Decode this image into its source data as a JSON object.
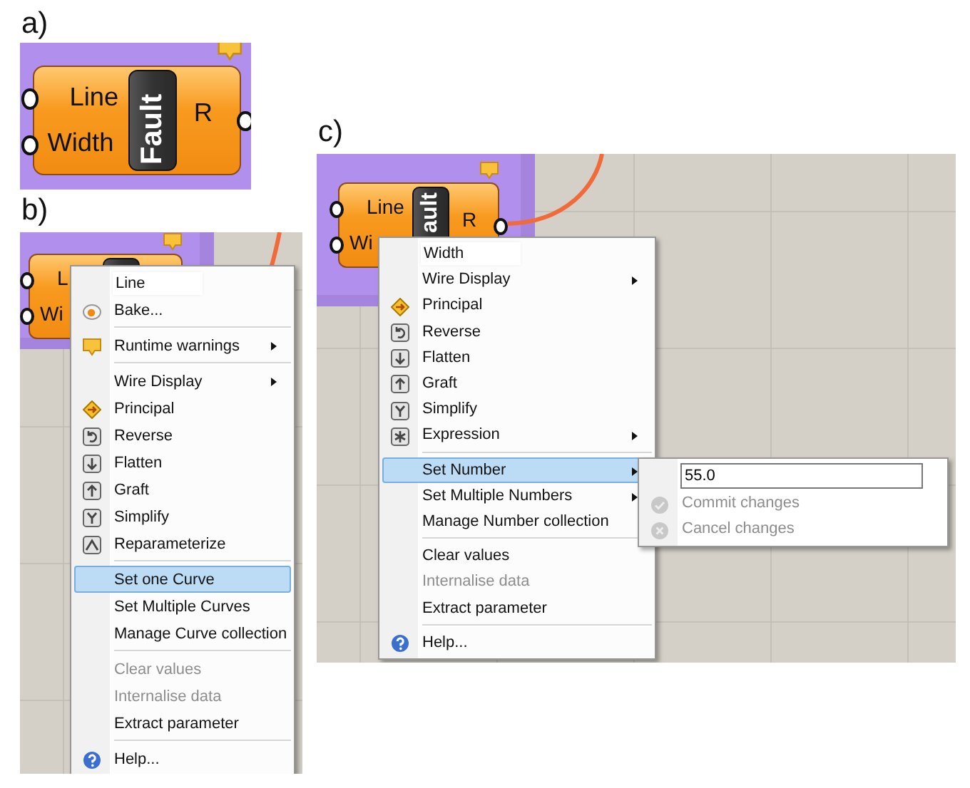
{
  "panels": [
    {
      "label": "a)",
      "grid": false,
      "node": {
        "inputs": [
          "Line",
          "Width"
        ],
        "name": "Fault",
        "output": "R",
        "warning": true
      }
    },
    {
      "label": "b)",
      "grid": true,
      "node": {
        "inputs": [
          "L",
          "Wi"
        ],
        "warning": true,
        "wire": true
      },
      "menu": {
        "items": [
          {
            "kind": "header",
            "label": "Line"
          },
          {
            "kind": "item",
            "label": "Bake...",
            "submenu": false,
            "disabled": false,
            "selected": false
          },
          {
            "kind": "separator"
          },
          {
            "kind": "item",
            "label": "Runtime warnings",
            "submenu": true,
            "disabled": false,
            "selected": false
          },
          {
            "kind": "separator"
          },
          {
            "kind": "item",
            "label": "Wire Display",
            "submenu": true,
            "disabled": false,
            "selected": false
          },
          {
            "kind": "item",
            "label": "Principal",
            "submenu": false,
            "disabled": false,
            "selected": false
          },
          {
            "kind": "item",
            "label": "Reverse",
            "submenu": false,
            "disabled": false,
            "selected": false
          },
          {
            "kind": "item",
            "label": "Flatten",
            "submenu": false,
            "disabled": false,
            "selected": false
          },
          {
            "kind": "item",
            "label": "Graft",
            "submenu": false,
            "disabled": false,
            "selected": false
          },
          {
            "kind": "item",
            "label": "Simplify",
            "submenu": false,
            "disabled": false,
            "selected": false
          },
          {
            "kind": "item",
            "label": "Reparameterize",
            "submenu": false,
            "disabled": false,
            "selected": false
          },
          {
            "kind": "separator"
          },
          {
            "kind": "item",
            "label": "Set one Curve",
            "submenu": false,
            "disabled": false,
            "selected": true
          },
          {
            "kind": "item",
            "label": "Set Multiple Curves",
            "submenu": false,
            "disabled": false,
            "selected": false
          },
          {
            "kind": "item",
            "label": "Manage Curve collection",
            "submenu": false,
            "disabled": false,
            "selected": false
          },
          {
            "kind": "separator"
          },
          {
            "kind": "item",
            "label": "Clear values",
            "submenu": false,
            "disabled": true,
            "selected": false
          },
          {
            "kind": "item",
            "label": "Internalise data",
            "submenu": false,
            "disabled": true,
            "selected": false
          },
          {
            "kind": "item",
            "label": "Extract parameter",
            "submenu": false,
            "disabled": false,
            "selected": false
          },
          {
            "kind": "separator"
          },
          {
            "kind": "item",
            "label": "Help...",
            "submenu": false,
            "disabled": false,
            "selected": false
          }
        ]
      }
    },
    {
      "label": "c)",
      "grid": true,
      "node": {
        "inputs": [
          "Line",
          "Wi"
        ],
        "name": "ault",
        "output": "R",
        "warning": true,
        "wire": true
      },
      "menu": {
        "items": [
          {
            "kind": "header",
            "label": "Width"
          },
          {
            "kind": "item",
            "label": "Wire Display",
            "submenu": true,
            "disabled": false,
            "selected": false
          },
          {
            "kind": "item",
            "label": "Principal",
            "submenu": false,
            "disabled": false,
            "selected": false
          },
          {
            "kind": "item",
            "label": "Reverse",
            "submenu": false,
            "disabled": false,
            "selected": false
          },
          {
            "kind": "item",
            "label": "Flatten",
            "submenu": false,
            "disabled": false,
            "selected": false
          },
          {
            "kind": "item",
            "label": "Graft",
            "submenu": false,
            "disabled": false,
            "selected": false
          },
          {
            "kind": "item",
            "label": "Simplify",
            "submenu": false,
            "disabled": false,
            "selected": false
          },
          {
            "kind": "item",
            "label": "Expression",
            "submenu": true,
            "disabled": false,
            "selected": false
          },
          {
            "kind": "separator"
          },
          {
            "kind": "item",
            "label": "Set Number",
            "submenu": true,
            "disabled": false,
            "selected": true
          },
          {
            "kind": "item",
            "label": "Set Multiple Numbers",
            "submenu": true,
            "disabled": false,
            "selected": false
          },
          {
            "kind": "item",
            "label": "Manage Number collection",
            "submenu": false,
            "disabled": false,
            "selected": false
          },
          {
            "kind": "separator"
          },
          {
            "kind": "item",
            "label": "Clear values",
            "submenu": false,
            "disabled": false,
            "selected": false
          },
          {
            "kind": "item",
            "label": "Internalise data",
            "submenu": false,
            "disabled": true,
            "selected": false
          },
          {
            "kind": "item",
            "label": "Extract parameter",
            "submenu": false,
            "disabled": false,
            "selected": false
          },
          {
            "kind": "separator"
          },
          {
            "kind": "item",
            "label": "Help...",
            "submenu": false,
            "disabled": false,
            "selected": false
          }
        ]
      },
      "submenu": {
        "field": {
          "value": "55.0"
        },
        "items": [
          {
            "label": "Commit changes",
            "disabled": true
          },
          {
            "label": "Cancel changes",
            "disabled": true
          }
        ]
      }
    }
  ]
}
